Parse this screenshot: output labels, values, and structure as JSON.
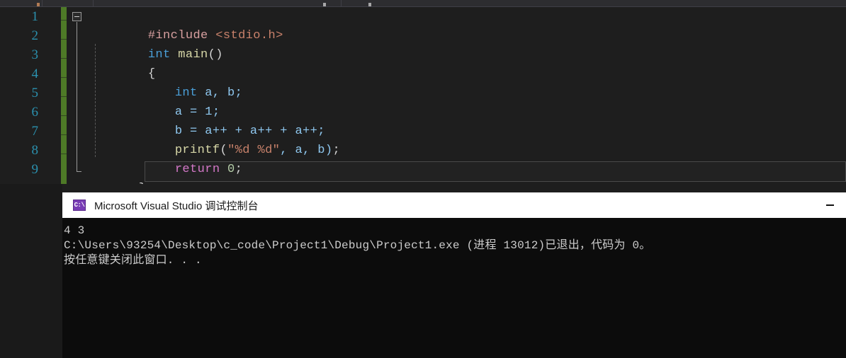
{
  "editor": {
    "line_numbers": [
      "1",
      "2",
      "3",
      "4",
      "5",
      "6",
      "7",
      "8",
      "9"
    ],
    "lines": [
      {
        "n": "1",
        "text": "#include <stdio.h>"
      },
      {
        "n": "2",
        "text": "int main()"
      },
      {
        "n": "3",
        "text": "{"
      },
      {
        "n": "4",
        "text": "int a, b;"
      },
      {
        "n": "5",
        "text": "a = 1;"
      },
      {
        "n": "6",
        "text": "b = a++ + a++ + a++;"
      },
      {
        "n": "7",
        "text": "printf(\"%d %d\", a, b);"
      },
      {
        "n": "8",
        "text": "return 0;"
      },
      {
        "n": "9",
        "text": "}"
      }
    ],
    "tokens": {
      "include_directive": "#include",
      "include_header": "<stdio.h>",
      "kw_int": "int",
      "fn_main": "main",
      "paren_empty": "()",
      "brace_open": "{",
      "brace_close": "}",
      "decl_type": "int",
      "decl_vars": " a, b;",
      "assign_line": "a = 1;",
      "incr_line": "b = a++ + a++ + a++;",
      "printf_name": "printf",
      "printf_open": "(",
      "printf_string": "\"%d %d\"",
      "printf_args": ", a, b)",
      "printf_semi": ";",
      "kw_return": "return",
      "return_value": " 0",
      "return_semi": ";"
    },
    "colors": {
      "background": "#1e1e1e",
      "line_number": "#2b91af",
      "change_bar": "#4e7a27",
      "keyword": "#4a9fd8",
      "string": "#c9826b",
      "function": "#d8d8a8",
      "variable": "#8fc8f0",
      "number": "#b5cea8",
      "return_keyword": "#d478c8"
    }
  },
  "console": {
    "title": "Microsoft Visual Studio 调试控制台",
    "icon_label": "C:\\",
    "icon_name": "console-app-icon",
    "minimize_label": "—",
    "output": [
      "4 3",
      "C:\\Users\\93254\\Desktop\\c_code\\Project1\\Debug\\Project1.exe (进程 13012)已退出，代码为 0。",
      "按任意键关闭此窗口. . ."
    ],
    "colors": {
      "title_bar": "#ffffff",
      "title_text": "#1a1a1a",
      "body_background": "#0c0c0c",
      "body_text": "#cccccc"
    }
  }
}
